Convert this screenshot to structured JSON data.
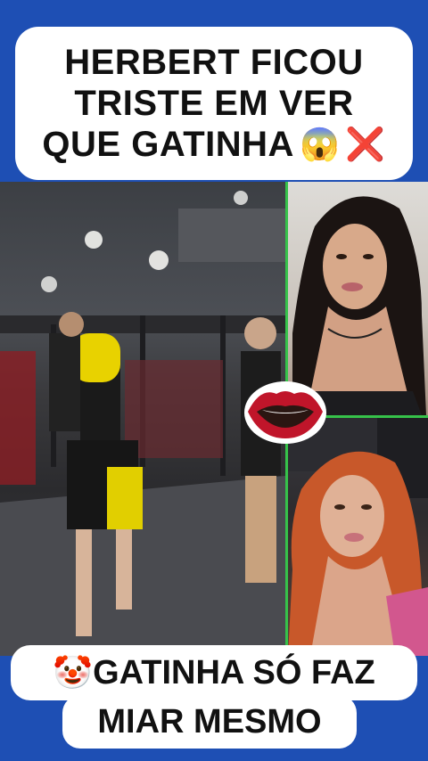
{
  "top_caption": {
    "line1": "HERBERT FICOU",
    "line2": "TRISTE EM VER",
    "line3": "QUE GATINHA",
    "emoji1": "😱",
    "emoji2": "❌"
  },
  "bottom_caption": {
    "emoji": "🤡",
    "line1": "GATINHA SÓ FAZ",
    "line2": "MIAR MESMO"
  },
  "icons": {
    "lips": "lips-icon"
  },
  "colors": {
    "background": "#1e4fb4",
    "caption_bg": "#ffffff",
    "divider": "#36c24a",
    "lips": "#c0152a"
  }
}
